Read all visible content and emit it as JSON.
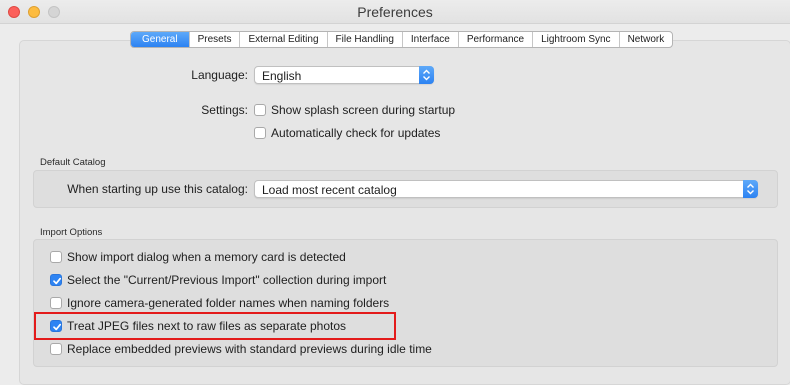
{
  "window": {
    "title": "Preferences"
  },
  "tabs": [
    {
      "label": "General",
      "active": true
    },
    {
      "label": "Presets",
      "active": false
    },
    {
      "label": "External Editing",
      "active": false
    },
    {
      "label": "File Handling",
      "active": false
    },
    {
      "label": "Interface",
      "active": false
    },
    {
      "label": "Performance",
      "active": false
    },
    {
      "label": "Lightroom Sync",
      "active": false
    },
    {
      "label": "Network",
      "active": false
    }
  ],
  "general": {
    "language_label": "Language:",
    "language_value": "English",
    "settings_label": "Settings:",
    "settings_options": [
      {
        "label": "Show splash screen during startup",
        "checked": false
      },
      {
        "label": "Automatically check for updates",
        "checked": false
      }
    ]
  },
  "default_catalog": {
    "section_title": "Default Catalog",
    "startup_label": "When starting up use this catalog:",
    "startup_value": "Load most recent catalog"
  },
  "import_options": {
    "section_title": "Import Options",
    "options": [
      {
        "label": "Show import dialog when a memory card is detected",
        "checked": false
      },
      {
        "label": "Select the \"Current/Previous Import\" collection during import",
        "checked": true
      },
      {
        "label": "Ignore camera-generated folder names when naming folders",
        "checked": false
      },
      {
        "label": "Treat JPEG files next to raw files as separate photos",
        "checked": true
      },
      {
        "label": "Replace embedded previews with standard previews during idle time",
        "checked": false
      }
    ]
  },
  "colors": {
    "accent": "#2e84f3",
    "highlight_box": "#e31b1b",
    "close": "#fc605b",
    "minimize": "#fdbc40"
  }
}
